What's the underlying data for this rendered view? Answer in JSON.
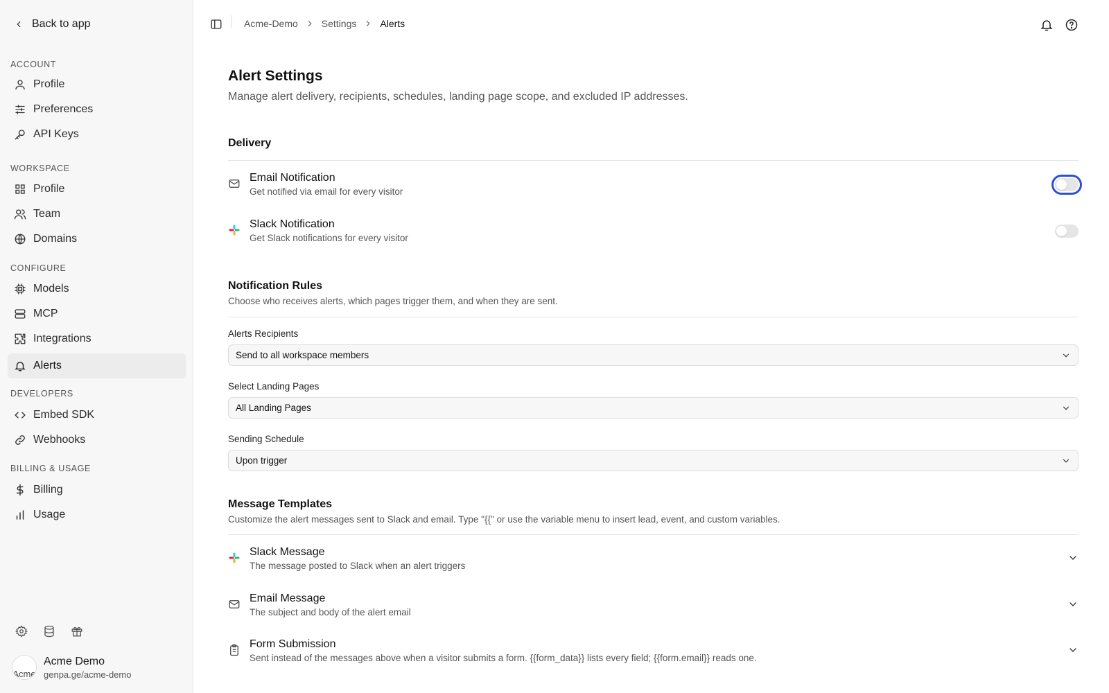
{
  "sidebar": {
    "back_label": "Back to app",
    "sections": [
      {
        "label": "ACCOUNT",
        "items": [
          {
            "label": "Profile",
            "icon": "user-icon"
          },
          {
            "label": "Preferences",
            "icon": "sliders-icon"
          },
          {
            "label": "API Keys",
            "icon": "key-icon"
          }
        ]
      },
      {
        "label": "WORKSPACE",
        "items": [
          {
            "label": "Profile",
            "icon": "grid-icon"
          },
          {
            "label": "Team",
            "icon": "users-icon"
          },
          {
            "label": "Domains",
            "icon": "globe-icon"
          }
        ]
      },
      {
        "label": "CONFIGURE",
        "items": [
          {
            "label": "Models",
            "icon": "chip-icon"
          },
          {
            "label": "MCP",
            "icon": "server-icon"
          },
          {
            "label": "Integrations",
            "icon": "puzzle-icon"
          },
          {
            "label": "Alerts",
            "icon": "bell-icon",
            "active": true
          }
        ]
      },
      {
        "label": "DEVELOPERS",
        "items": [
          {
            "label": "Embed SDK",
            "icon": "code-icon"
          },
          {
            "label": "Webhooks",
            "icon": "link-icon"
          }
        ]
      },
      {
        "label": "BILLING & USAGE",
        "items": [
          {
            "label": "Billing",
            "icon": "dollar-icon"
          },
          {
            "label": "Usage",
            "icon": "bar-chart-icon"
          }
        ]
      }
    ],
    "footer_icons": [
      "gear-icon",
      "database-icon",
      "gift-icon"
    ],
    "user": {
      "avatar_alt": "Acme",
      "name": "Acme Demo",
      "url": "genpa.ge/acme-demo"
    }
  },
  "topbar": {
    "breadcrumb": [
      "Acme-Demo",
      "Settings",
      "Alerts"
    ],
    "icons": [
      "bell-icon",
      "help-icon"
    ]
  },
  "page": {
    "title": "Alert Settings",
    "subtitle": "Manage alert delivery, recipients, schedules, landing page scope, and excluded IP addresses."
  },
  "delivery": {
    "title": "Delivery",
    "email": {
      "title": "Email Notification",
      "desc": "Get notified via email for every visitor",
      "enabled": false,
      "focused": true
    },
    "slack": {
      "title": "Slack Notification",
      "desc": "Get Slack notifications for every visitor",
      "enabled": false
    }
  },
  "rules": {
    "title": "Notification Rules",
    "subtitle": "Choose who receives alerts, which pages trigger them, and when they are sent.",
    "recipients": {
      "label": "Alerts Recipients",
      "value": "Send to all workspace members"
    },
    "landing_pages": {
      "label": "Select Landing Pages",
      "value": "All Landing Pages"
    },
    "schedule": {
      "label": "Sending Schedule",
      "value": "Upon trigger"
    }
  },
  "templates": {
    "title": "Message Templates",
    "subtitle": "Customize the alert messages sent to Slack and email. Type \"{{\" or use the variable menu to insert lead, event, and custom variables.",
    "slack": {
      "title": "Slack Message",
      "desc": "The message posted to Slack when an alert triggers"
    },
    "email": {
      "title": "Email Message",
      "desc": "The subject and body of the alert email"
    },
    "form": {
      "title": "Form Submission",
      "desc": "Sent instead of the messages above when a visitor submits a form. {{form_data}} lists every field; {{form.email}} reads one."
    }
  },
  "colors": {
    "sidebar_bg": "#f7f7f7",
    "focus_ring": "#2d4fd6",
    "switch_off": "#e5e5e5"
  }
}
